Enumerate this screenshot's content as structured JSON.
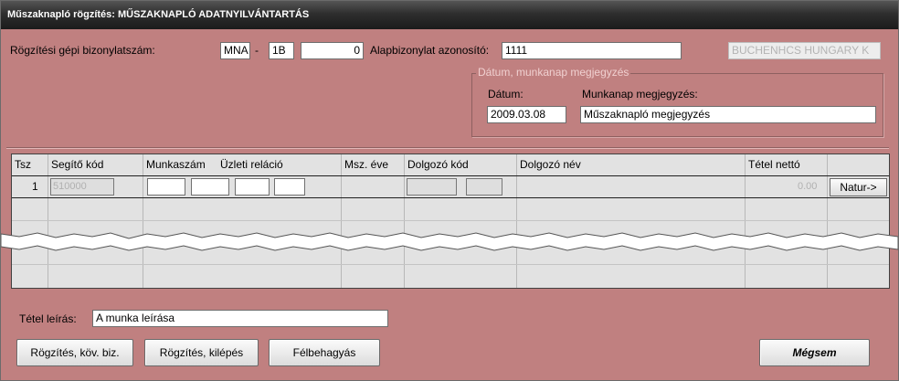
{
  "window": {
    "title": "Műszaknapló rögzítés: MŰSZAKNAPLÓ ADATNYILVÁNTARTÁS"
  },
  "header": {
    "doc_number_label": "Rögzítési gépi bizonylatszám:",
    "prefix": "MNA",
    "dash": "-",
    "series": "1B",
    "number": "0",
    "base_doc_label": "Alapbizonylat azonosító:",
    "base_doc_value": "1111",
    "company": "BUCHENHCS HUNGARY K"
  },
  "date_group": {
    "title": "Dátum, munkanap megjegyzés",
    "date_label": "Dátum:",
    "date_value": "2009.03.08",
    "note_label": "Munkanap megjegyzés:",
    "note_value": "Műszaknapló megjegyzés"
  },
  "grid": {
    "columns": [
      "Tsz",
      "Segítő kód",
      "Munkaszám",
      "Üzleti reláció",
      "Msz. éve",
      "Dolgozó kód",
      "Dolgozó név",
      "Tétel nettó"
    ],
    "row": {
      "tsz": "1",
      "code": "510000",
      "net": "0.00",
      "natur_button": "Natur->"
    }
  },
  "description": {
    "label": "Tétel leírás:",
    "value": "A munka leírása"
  },
  "buttons": {
    "save_next": "Rögzítés, köv. biz.",
    "save_exit": "Rögzítés, kilépés",
    "suspend": "Félbehagyás",
    "cancel": "Mégsem"
  },
  "colors": {
    "background": "#c08080",
    "titlebar": "#2e2e2e"
  }
}
